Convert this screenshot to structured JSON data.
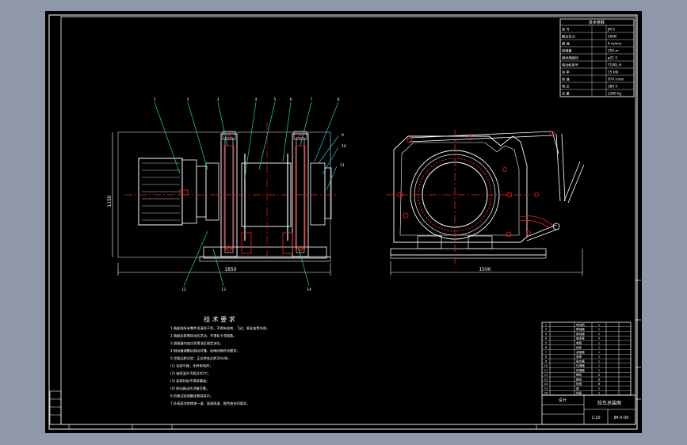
{
  "title_block": {
    "header": "技术参数",
    "rows": [
      {
        "label": "型 号",
        "value": "JM-5"
      },
      {
        "label": "额定拉力",
        "value": "50kN"
      },
      {
        "label": "绳 速",
        "value": "9 m/min"
      },
      {
        "label": "容绳量",
        "value": "250 m"
      },
      {
        "label": "钢丝绳直径",
        "value": "φ21.5"
      },
      {
        "label": "电动机型号",
        "value": "Y180L-6"
      },
      {
        "label": "功 率",
        "value": "15 kW"
      },
      {
        "label": "转 速",
        "value": "970 r/min"
      },
      {
        "label": "电 压",
        "value": "380 V"
      },
      {
        "label": "总 重",
        "value": "2300 kg"
      }
    ]
  },
  "dimensions": {
    "side_width": "1850",
    "side_height": "1150",
    "front_width": "1500"
  },
  "tech_requirements": {
    "title": "技 术 要 求",
    "lines": [
      "1.装配前所有零件须清洗干净，不得有毛刺、飞边、氧化皮等杂质。",
      "2.装配后卷筒转动应灵活，不得有卡滞现象。",
      "3.减速器内加注润滑油至规定油位。",
      "4.制动器调整后制动可靠，松闸间隙符合要求。",
      "5.空载运转试验：正反转各运转30分钟。",
      "  (1) 运转平稳，无异常响声；",
      "  (2) 轴承温升不超过40℃；",
      "  (3) 各密封处不得渗漏油；",
      "  (4) 制动器动作灵敏可靠。",
      "6.负载试验按额定载荷进行。",
      "7.外表面涂防锈漆一道，面漆两道，颜色按合同要求。"
    ]
  },
  "bom_rows": [
    {
      "no": "1",
      "name": "电动机",
      "qty": "1"
    },
    {
      "no": "2",
      "name": "联轴器",
      "qty": "1"
    },
    {
      "no": "3",
      "name": "制动器",
      "qty": "1"
    },
    {
      "no": "4",
      "name": "轴承座",
      "qty": "2"
    },
    {
      "no": "5",
      "name": "卷筒",
      "qty": "1"
    },
    {
      "no": "6",
      "name": "齿轮",
      "qty": "1"
    },
    {
      "no": "7",
      "name": "减速器",
      "qty": "1"
    },
    {
      "no": "8",
      "name": "底座",
      "qty": "1"
    },
    {
      "no": "9",
      "name": "离合器",
      "qty": "1"
    },
    {
      "no": "10",
      "name": "压绳器",
      "qty": "1"
    },
    {
      "no": "11",
      "name": "排绳器",
      "qty": "1"
    },
    {
      "no": "12",
      "name": "螺栓",
      "qty": "8"
    },
    {
      "no": "13",
      "name": "螺母",
      "qty": "8"
    },
    {
      "no": "14",
      "name": "垫圈",
      "qty": "8"
    },
    {
      "no": "15",
      "name": "键",
      "qty": "2"
    },
    {
      "no": "16",
      "name": "挡板",
      "qty": "2"
    }
  ],
  "title_bottom": {
    "drawing_name": "绞车总装图",
    "drawing_no": "JM-5-00",
    "company": "设计",
    "scale": "1:10"
  },
  "part_callouts_top": [
    "1",
    "2",
    "3",
    "4",
    "5",
    "6",
    "7",
    "8"
  ],
  "part_callouts_right": [
    "9",
    "10",
    "11"
  ],
  "part_callouts_bottom": [
    "12",
    "13",
    "14"
  ],
  "colors": {
    "background": "#000000",
    "border": "#ffffff",
    "centerline": "#ff2020",
    "leader": "#1fd0c8",
    "outline": "#ffffff",
    "frame_gray": "#8f98a9"
  }
}
